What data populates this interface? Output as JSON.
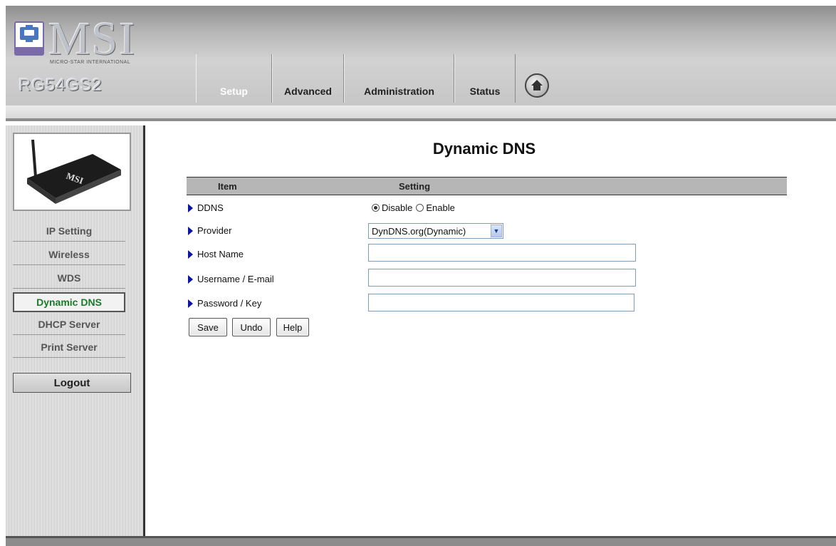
{
  "header": {
    "brand": "MSI",
    "brand_sub": "MICRO-STAR INTERNATIONAL",
    "model": "RG54GS2",
    "tabs": [
      {
        "label": "Setup",
        "active": true
      },
      {
        "label": "Advanced",
        "active": false
      },
      {
        "label": "Administration",
        "active": false
      },
      {
        "label": "Status",
        "active": false
      }
    ],
    "home_icon": "home-icon"
  },
  "sidebar": {
    "product_image_text": "MSI",
    "items": [
      {
        "label": "IP Setting",
        "active": false
      },
      {
        "label": "Wireless",
        "active": false
      },
      {
        "label": "WDS",
        "active": false
      },
      {
        "label": "Dynamic DNS",
        "active": true
      },
      {
        "label": "DHCP Server",
        "active": false
      },
      {
        "label": "Print Server",
        "active": false
      }
    ],
    "logout_label": "Logout",
    "active_color": "#1b7a2a"
  },
  "main": {
    "title": "Dynamic DNS",
    "table": {
      "col_item": "Item",
      "col_setting": "Setting"
    },
    "rows": {
      "ddns": {
        "label": "DDNS",
        "options": [
          "Disable",
          "Enable"
        ],
        "selected": "Disable"
      },
      "provider": {
        "label": "Provider",
        "value": "DynDNS.org(Dynamic)"
      },
      "host_name": {
        "label": "Host Name",
        "value": ""
      },
      "username": {
        "label": "Username / E-mail",
        "value": ""
      },
      "password": {
        "label": "Password / Key",
        "value": ""
      }
    },
    "buttons": {
      "save": "Save",
      "undo": "Undo",
      "help": "Help"
    },
    "arrow_color": "#0a14a8"
  }
}
